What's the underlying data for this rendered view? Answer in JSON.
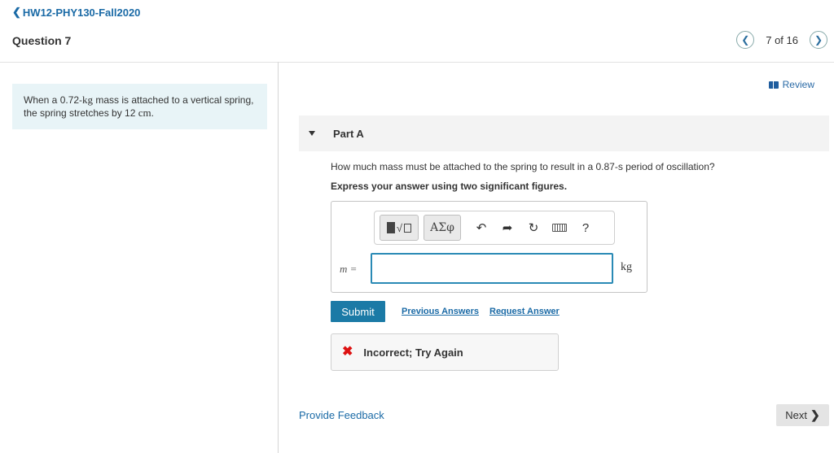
{
  "header": {
    "back_label": "HW12-PHY130-Fall2020",
    "question_title": "Question 7",
    "page_count": "7 of 16"
  },
  "prompt": {
    "text_1": "When a 0.72-",
    "unit_kg": "kg",
    "text_2": " mass is attached to a vertical spring, the spring stretches by 12 ",
    "unit_cm": "cm",
    "text_3": "."
  },
  "review_label": "Review",
  "part": {
    "label": "Part A",
    "question": "How much mass must be attached to the spring to result in a 0.87-s period of oscillation?",
    "instruction": "Express your answer using two significant figures."
  },
  "toolbar": {
    "greek_label": "ΑΣφ",
    "undo_icon": "undo-icon",
    "redo_icon": "redo-icon",
    "reset_icon": "reset-icon",
    "keyboard_icon": "keyboard-icon",
    "help_label": "?"
  },
  "answer": {
    "variable": "m =",
    "value": "",
    "unit": "kg"
  },
  "actions": {
    "submit": "Submit",
    "previous_answers": "Previous Answers",
    "request_answer": "Request Answer"
  },
  "feedback": {
    "icon": "x-icon",
    "text": "Incorrect; Try Again"
  },
  "footer": {
    "provide_feedback": "Provide Feedback",
    "next": "Next"
  },
  "colors": {
    "accent": "#1b7aa6",
    "link": "#1a6aa6",
    "error": "#dd1111",
    "prompt_bg": "#e8f4f7"
  }
}
